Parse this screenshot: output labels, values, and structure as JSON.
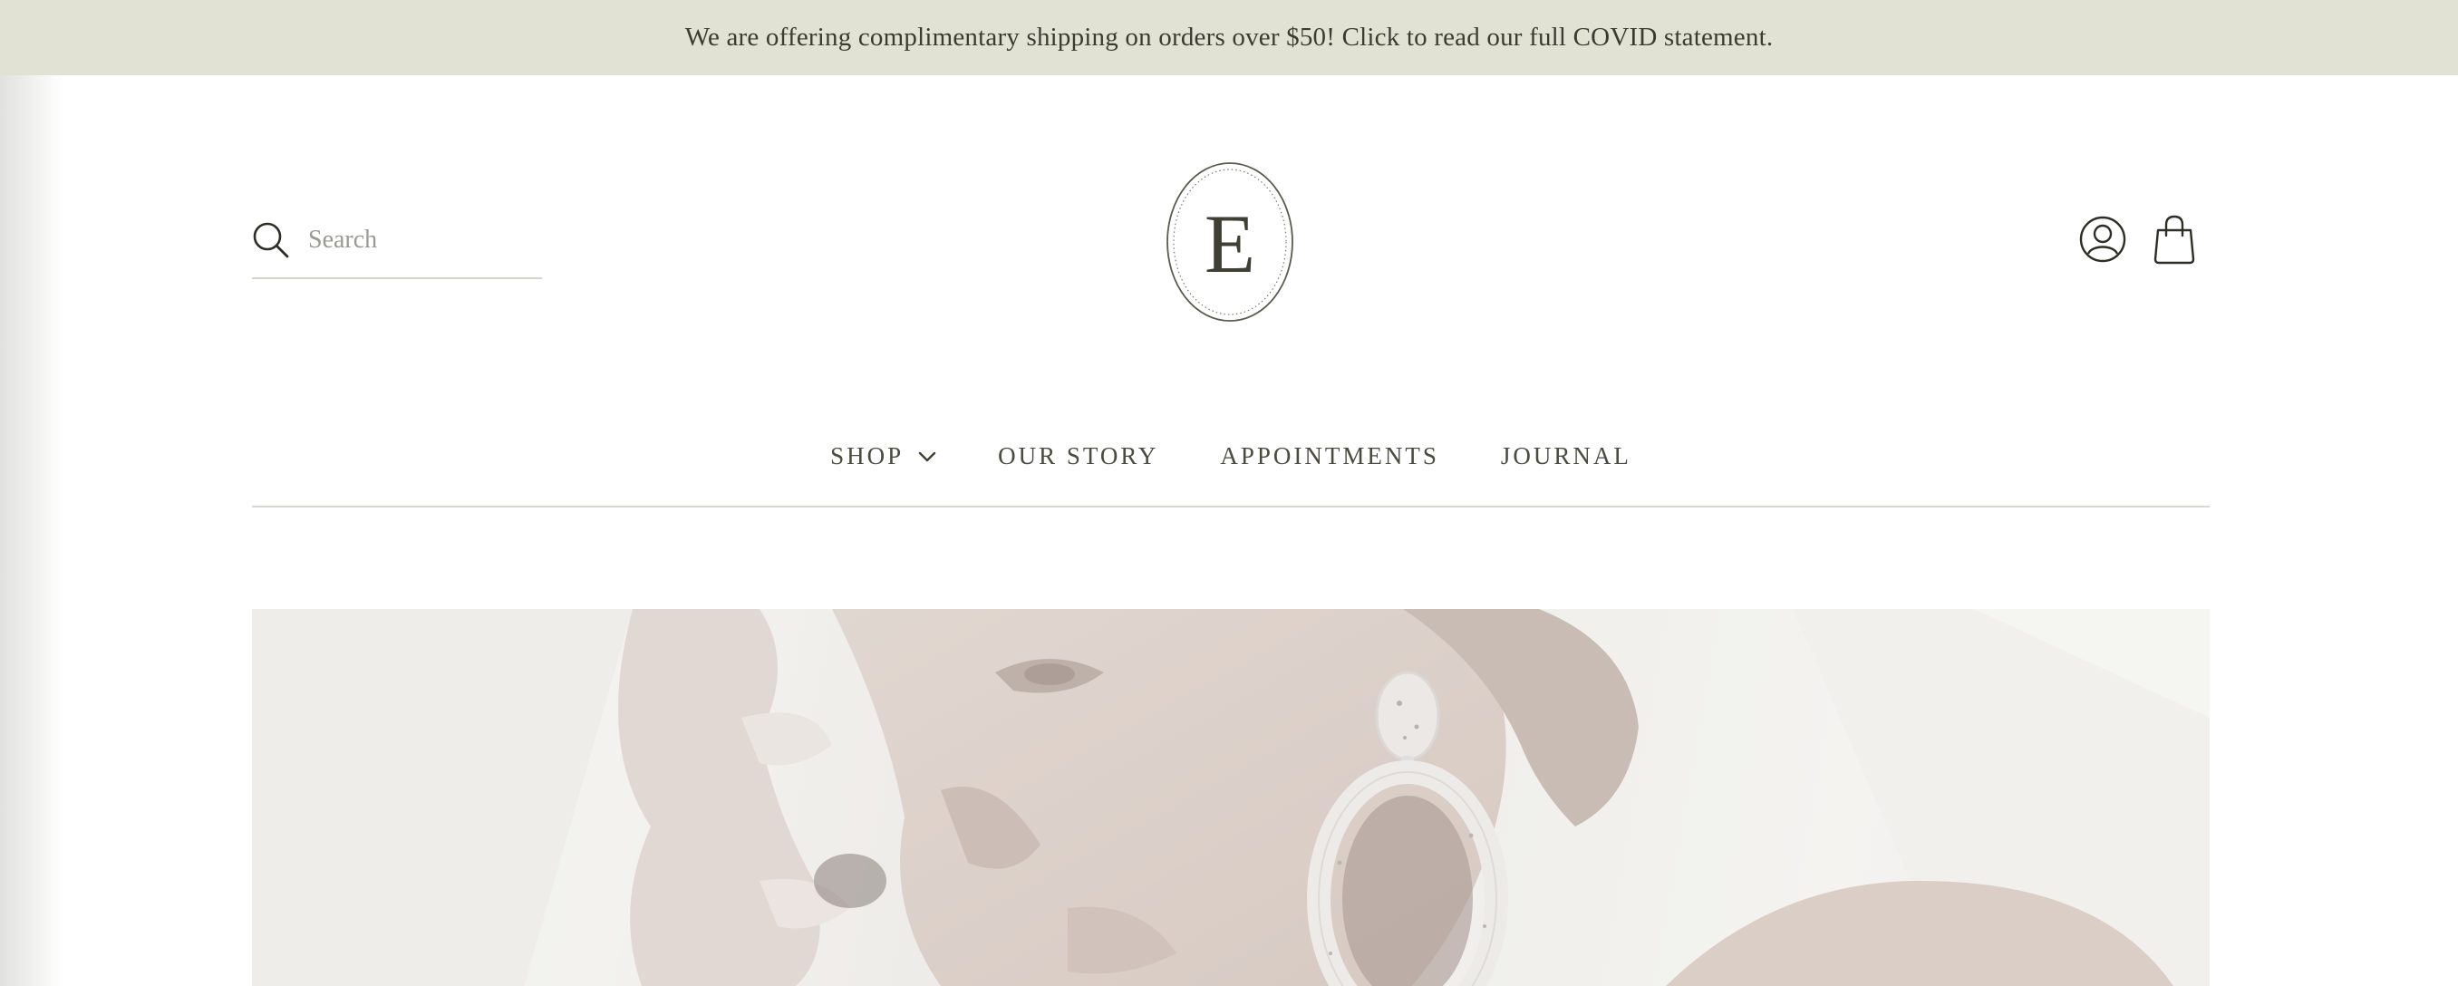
{
  "announcement": {
    "text": "We are offering complimentary shipping on orders over $50! Click to read our full COVID statement."
  },
  "header": {
    "search": {
      "placeholder": "Search",
      "value": ""
    },
    "logo": {
      "letter": "E"
    },
    "icons": {
      "search": "search-icon",
      "account": "user-icon",
      "cart": "shopping-bag-icon"
    }
  },
  "nav": {
    "items": [
      {
        "label": "SHOP",
        "has_dropdown": true
      },
      {
        "label": "OUR STORY"
      },
      {
        "label": "APPOINTMENTS"
      },
      {
        "label": "JOURNAL"
      }
    ]
  },
  "colors": {
    "announcement_bg": "#e2e2d4",
    "text": "#3f3f34",
    "divider": "#d8d8d2"
  }
}
